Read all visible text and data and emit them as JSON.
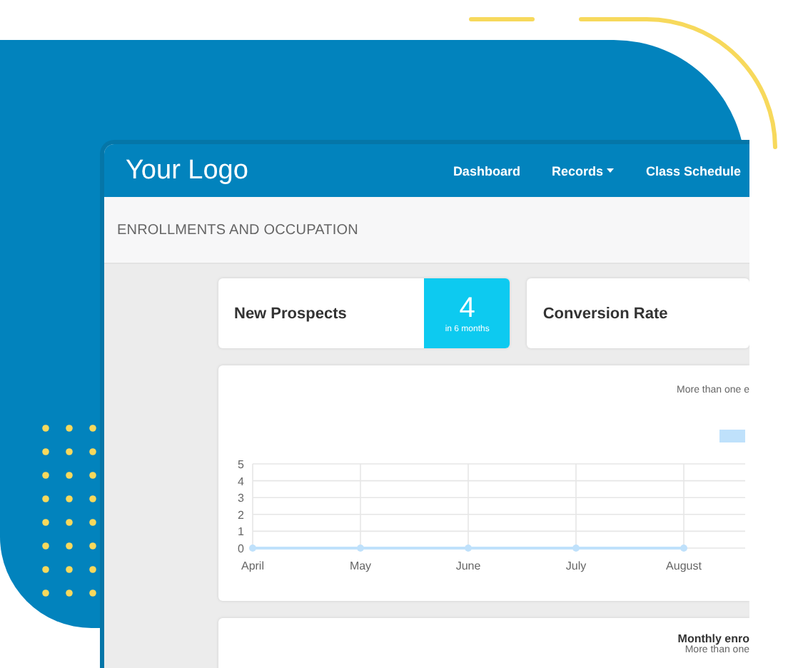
{
  "logo": "Your Logo",
  "nav": [
    {
      "label": "Dashboard",
      "dropdown": false
    },
    {
      "label": "Records",
      "dropdown": true
    },
    {
      "label": "Class Schedule",
      "dropdown": false
    }
  ],
  "page_title": "ENROLLMENTS AND OCCUPATION",
  "stats": [
    {
      "label": "New Prospects",
      "value": "4",
      "caption": "in 6 months"
    },
    {
      "label": "Conversion Rate"
    }
  ],
  "enrollment_chart": {
    "subtitle": "More than one e",
    "chart_data": {
      "type": "line",
      "categories": [
        "April",
        "May",
        "June",
        "July",
        "August"
      ],
      "series": [
        {
          "color": "#bfe1fb",
          "values": [
            0,
            0,
            0,
            0,
            0
          ],
          "marker": "circle"
        }
      ],
      "ylim": [
        0,
        5
      ],
      "yticks": [
        0,
        1,
        2,
        3,
        4,
        5
      ],
      "grid": true
    }
  },
  "monthly_panel": {
    "title": "Monthly enro",
    "subtitle": "More than one"
  }
}
